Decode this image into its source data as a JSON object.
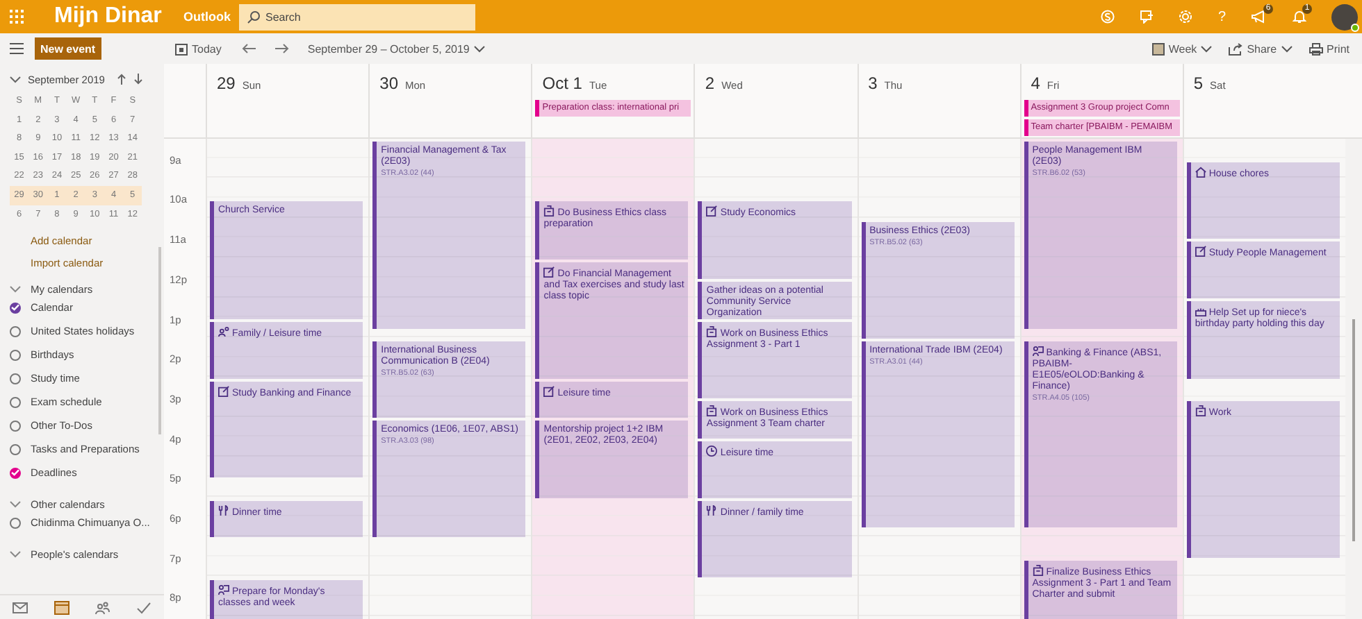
{
  "header": {
    "app_name": "Mijn Dinar",
    "product": "Outlook",
    "search": {
      "placeholder": "Search"
    },
    "help": "?",
    "news_badge": "6",
    "alerts_badge": "1"
  },
  "toolbar": {
    "new_event": "New event",
    "today": "Today",
    "date_range": "September 29 – October 5, 2019",
    "view": "Week",
    "share": "Share",
    "print": "Print"
  },
  "mini_calendar": {
    "month": "September 2019",
    "weekdays": [
      "S",
      "M",
      "T",
      "W",
      "T",
      "F",
      "S"
    ],
    "weeks": [
      {
        "days": [
          "1",
          "2",
          "3",
          "4",
          "5",
          "6",
          "7"
        ],
        "selected": false
      },
      {
        "days": [
          "8",
          "9",
          "10",
          "11",
          "12",
          "13",
          "14"
        ],
        "selected": false
      },
      {
        "days": [
          "15",
          "16",
          "17",
          "18",
          "19",
          "20",
          "21"
        ],
        "selected": false
      },
      {
        "days": [
          "22",
          "23",
          "24",
          "25",
          "26",
          "27",
          "28"
        ],
        "selected": false
      },
      {
        "days": [
          "29",
          "30",
          "1",
          "2",
          "3",
          "4",
          "5"
        ],
        "selected": true
      },
      {
        "days": [
          "6",
          "7",
          "8",
          "9",
          "10",
          "11",
          "12"
        ],
        "selected": false
      }
    ]
  },
  "sidebar": {
    "links": [
      "Add calendar",
      "Import calendar"
    ],
    "groups": [
      {
        "title": "My calendars",
        "items": [
          {
            "name": "Calendar",
            "checked": true,
            "color": "#6b3fa0"
          },
          {
            "name": "United States holidays",
            "checked": false
          },
          {
            "name": "Birthdays",
            "checked": false
          },
          {
            "name": "Study time",
            "checked": false
          },
          {
            "name": "Exam schedule",
            "checked": false
          },
          {
            "name": "Other To-Dos",
            "checked": false
          },
          {
            "name": "Tasks and Preparations",
            "checked": false
          },
          {
            "name": "Deadlines",
            "checked": true,
            "color": "#e3008c"
          }
        ]
      },
      {
        "title": "Other calendars",
        "items": [
          {
            "name": "Chidinma Chimuanya O...",
            "checked": false
          }
        ]
      },
      {
        "title": "People's calendars"
      }
    ]
  },
  "bottom_nav": [
    {
      "kind": "mail",
      "selected": false
    },
    {
      "kind": "calendar",
      "selected": true
    },
    {
      "kind": "people",
      "selected": false
    },
    {
      "kind": "todo",
      "selected": false
    }
  ],
  "hours": [
    "9a",
    "10a",
    "11a",
    "12p",
    "1p",
    "2p",
    "3p",
    "4p",
    "5p",
    "6p",
    "7p",
    "8p"
  ],
  "days": [
    {
      "number": "29",
      "weekday": "Sun",
      "highlighted": false,
      "events": [
        {
          "title": "Church Service",
          "kind": "plain"
        },
        {
          "title": "Family / Leisure time",
          "kind": "people"
        },
        {
          "title": "Study Banking and Finance",
          "kind": "note"
        },
        {
          "title": "Dinner time",
          "kind": "meal"
        },
        {
          "title": "Prepare for Monday's classes and week",
          "kind": "class"
        }
      ]
    },
    {
      "number": "30",
      "weekday": "Mon",
      "highlighted": false,
      "events": [
        {
          "title": "Financial Management & Tax (2E03)",
          "location": "STR.A3.02 (44)",
          "kind": "plain"
        },
        {
          "title": "International Business Communication B (2E04)",
          "location": "STR.B5.02 (63)",
          "kind": "plain"
        },
        {
          "title": "Economics (1E06, 1E07, ABS1)",
          "location": "STR.A3.03 (98)",
          "kind": "plain"
        }
      ]
    },
    {
      "number": "Oct 1",
      "weekday": "Tue",
      "highlighted": true,
      "all_day": [
        "Preparation class: international pri"
      ],
      "events": [
        {
          "title": "Do Business Ethics class preparation",
          "kind": "work"
        },
        {
          "title": "Do Financial Management and Tax exercises and study last class topic",
          "kind": "note"
        },
        {
          "title": "Leisure time",
          "kind": "note"
        },
        {
          "title": "Mentorship project 1+2 IBM (2E01, 2E02, 2E03, 2E04)",
          "kind": "plain"
        }
      ]
    },
    {
      "number": "2",
      "weekday": "Wed",
      "highlighted": false,
      "events": [
        {
          "title": "Study Economics",
          "kind": "note"
        },
        {
          "title": "Gather ideas on a potential Community Service Organization",
          "kind": "plain"
        },
        {
          "title": "Work on Business Ethics Assignment 3 - Part 1",
          "kind": "work"
        },
        {
          "title": "Work on Business Ethics Assignment 3 Team charter",
          "kind": "work"
        },
        {
          "title": "Leisure time",
          "kind": "clock"
        },
        {
          "title": "Dinner / family time",
          "kind": "meal"
        }
      ]
    },
    {
      "number": "3",
      "weekday": "Thu",
      "highlighted": false,
      "events": [
        {
          "title": "Business Ethics (2E03)",
          "location": "STR.B5.02 (63)",
          "kind": "plain"
        },
        {
          "title": "International Trade IBM (2E04)",
          "location": "STR.A3.01 (44)",
          "kind": "plain"
        }
      ]
    },
    {
      "number": "4",
      "weekday": "Fri",
      "highlighted": true,
      "all_day": [
        "Assignment 3 Group project Comn",
        "Team charter [PBAIBM - PEMAIBM"
      ],
      "events": [
        {
          "title": "People Management IBM (2E03)",
          "location": "STR.B6.02 (53)",
          "kind": "plain"
        },
        {
          "title": "Banking & Finance (ABS1, PBAIBM-E1E05/eOLOD:Banking & Finance)",
          "location": "STR.A4.05 (105)",
          "kind": "class"
        },
        {
          "title": "Finalize Business Ethics Assignment 3 - Part 1 and Team Charter and submit",
          "kind": "work"
        }
      ]
    },
    {
      "number": "5",
      "weekday": "Sat",
      "highlighted": false,
      "events": [
        {
          "title": "House chores",
          "kind": "home"
        },
        {
          "title": "Study People Management",
          "kind": "note"
        },
        {
          "title": "Help Set up for niece's birthday party holding this day",
          "kind": "cake"
        },
        {
          "title": "Work",
          "kind": "work"
        }
      ]
    }
  ]
}
